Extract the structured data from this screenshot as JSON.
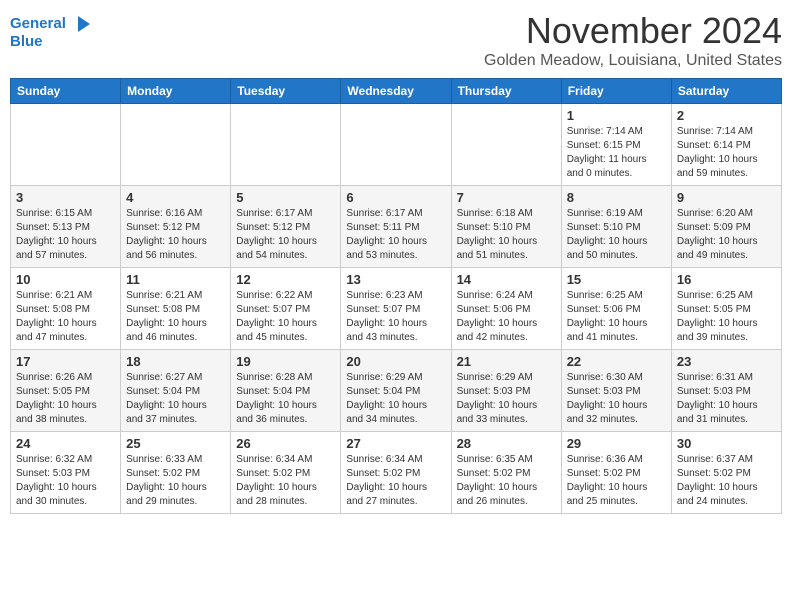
{
  "logo": {
    "line1": "General",
    "line2": "Blue"
  },
  "title": "November 2024",
  "location": "Golden Meadow, Louisiana, United States",
  "days_of_week": [
    "Sunday",
    "Monday",
    "Tuesday",
    "Wednesday",
    "Thursday",
    "Friday",
    "Saturday"
  ],
  "weeks": [
    [
      {
        "day": "",
        "info": ""
      },
      {
        "day": "",
        "info": ""
      },
      {
        "day": "",
        "info": ""
      },
      {
        "day": "",
        "info": ""
      },
      {
        "day": "",
        "info": ""
      },
      {
        "day": "1",
        "info": "Sunrise: 7:14 AM\nSunset: 6:15 PM\nDaylight: 11 hours\nand 0 minutes."
      },
      {
        "day": "2",
        "info": "Sunrise: 7:14 AM\nSunset: 6:14 PM\nDaylight: 10 hours\nand 59 minutes."
      }
    ],
    [
      {
        "day": "3",
        "info": "Sunrise: 6:15 AM\nSunset: 5:13 PM\nDaylight: 10 hours\nand 57 minutes."
      },
      {
        "day": "4",
        "info": "Sunrise: 6:16 AM\nSunset: 5:12 PM\nDaylight: 10 hours\nand 56 minutes."
      },
      {
        "day": "5",
        "info": "Sunrise: 6:17 AM\nSunset: 5:12 PM\nDaylight: 10 hours\nand 54 minutes."
      },
      {
        "day": "6",
        "info": "Sunrise: 6:17 AM\nSunset: 5:11 PM\nDaylight: 10 hours\nand 53 minutes."
      },
      {
        "day": "7",
        "info": "Sunrise: 6:18 AM\nSunset: 5:10 PM\nDaylight: 10 hours\nand 51 minutes."
      },
      {
        "day": "8",
        "info": "Sunrise: 6:19 AM\nSunset: 5:10 PM\nDaylight: 10 hours\nand 50 minutes."
      },
      {
        "day": "9",
        "info": "Sunrise: 6:20 AM\nSunset: 5:09 PM\nDaylight: 10 hours\nand 49 minutes."
      }
    ],
    [
      {
        "day": "10",
        "info": "Sunrise: 6:21 AM\nSunset: 5:08 PM\nDaylight: 10 hours\nand 47 minutes."
      },
      {
        "day": "11",
        "info": "Sunrise: 6:21 AM\nSunset: 5:08 PM\nDaylight: 10 hours\nand 46 minutes."
      },
      {
        "day": "12",
        "info": "Sunrise: 6:22 AM\nSunset: 5:07 PM\nDaylight: 10 hours\nand 45 minutes."
      },
      {
        "day": "13",
        "info": "Sunrise: 6:23 AM\nSunset: 5:07 PM\nDaylight: 10 hours\nand 43 minutes."
      },
      {
        "day": "14",
        "info": "Sunrise: 6:24 AM\nSunset: 5:06 PM\nDaylight: 10 hours\nand 42 minutes."
      },
      {
        "day": "15",
        "info": "Sunrise: 6:25 AM\nSunset: 5:06 PM\nDaylight: 10 hours\nand 41 minutes."
      },
      {
        "day": "16",
        "info": "Sunrise: 6:25 AM\nSunset: 5:05 PM\nDaylight: 10 hours\nand 39 minutes."
      }
    ],
    [
      {
        "day": "17",
        "info": "Sunrise: 6:26 AM\nSunset: 5:05 PM\nDaylight: 10 hours\nand 38 minutes."
      },
      {
        "day": "18",
        "info": "Sunrise: 6:27 AM\nSunset: 5:04 PM\nDaylight: 10 hours\nand 37 minutes."
      },
      {
        "day": "19",
        "info": "Sunrise: 6:28 AM\nSunset: 5:04 PM\nDaylight: 10 hours\nand 36 minutes."
      },
      {
        "day": "20",
        "info": "Sunrise: 6:29 AM\nSunset: 5:04 PM\nDaylight: 10 hours\nand 34 minutes."
      },
      {
        "day": "21",
        "info": "Sunrise: 6:29 AM\nSunset: 5:03 PM\nDaylight: 10 hours\nand 33 minutes."
      },
      {
        "day": "22",
        "info": "Sunrise: 6:30 AM\nSunset: 5:03 PM\nDaylight: 10 hours\nand 32 minutes."
      },
      {
        "day": "23",
        "info": "Sunrise: 6:31 AM\nSunset: 5:03 PM\nDaylight: 10 hours\nand 31 minutes."
      }
    ],
    [
      {
        "day": "24",
        "info": "Sunrise: 6:32 AM\nSunset: 5:03 PM\nDaylight: 10 hours\nand 30 minutes."
      },
      {
        "day": "25",
        "info": "Sunrise: 6:33 AM\nSunset: 5:02 PM\nDaylight: 10 hours\nand 29 minutes."
      },
      {
        "day": "26",
        "info": "Sunrise: 6:34 AM\nSunset: 5:02 PM\nDaylight: 10 hours\nand 28 minutes."
      },
      {
        "day": "27",
        "info": "Sunrise: 6:34 AM\nSunset: 5:02 PM\nDaylight: 10 hours\nand 27 minutes."
      },
      {
        "day": "28",
        "info": "Sunrise: 6:35 AM\nSunset: 5:02 PM\nDaylight: 10 hours\nand 26 minutes."
      },
      {
        "day": "29",
        "info": "Sunrise: 6:36 AM\nSunset: 5:02 PM\nDaylight: 10 hours\nand 25 minutes."
      },
      {
        "day": "30",
        "info": "Sunrise: 6:37 AM\nSunset: 5:02 PM\nDaylight: 10 hours\nand 24 minutes."
      }
    ]
  ]
}
